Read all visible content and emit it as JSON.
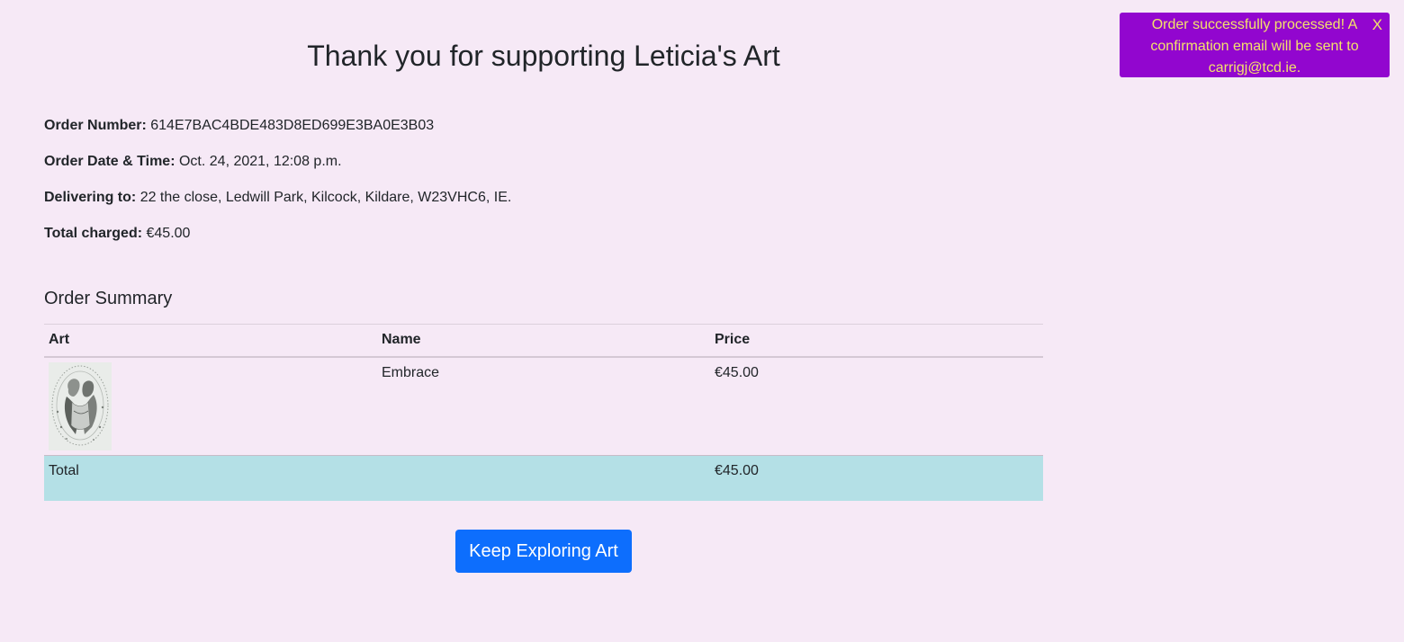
{
  "page": {
    "title": "Thank you for supporting Leticia's Art"
  },
  "order_details": {
    "number_label": "Order Number:",
    "number_value": "614E7BAC4BDE483D8ED699E3BA0E3B03",
    "date_label": "Order Date & Time:",
    "date_value": "Oct. 24, 2021, 12:08 p.m.",
    "delivery_label": "Delivering to:",
    "delivery_value": "22 the close, Ledwill Park, Kilcock, Kildare, W23VHC6, IE.",
    "total_label": "Total charged:",
    "total_value": "€45.00"
  },
  "summary": {
    "heading": "Order Summary",
    "columns": [
      "Art",
      "Name",
      "Price"
    ],
    "items": [
      {
        "name": "Embrace",
        "price": "€45.00",
        "thumbnail_icon": "art-thumbnail-embrace"
      }
    ],
    "total_label": "Total",
    "total_value": "€45.00"
  },
  "actions": {
    "keep_exploring_label": "Keep Exploring Art"
  },
  "toast": {
    "message": "Order successfully processed! A confirmation email will be sent to carrigj@tcd.ie.",
    "close_label": "X"
  },
  "colors": {
    "page_background": "#f6e9f6",
    "button_primary": "#0d6efd",
    "toast_background": "#9206cf",
    "toast_text": "#f3e26a",
    "total_row_background": "#b4e0e6"
  }
}
